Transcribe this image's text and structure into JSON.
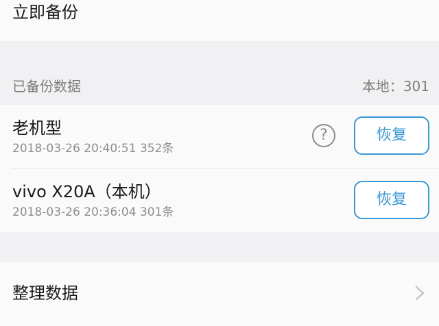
{
  "backup_now": {
    "label": "立即备份"
  },
  "backed_up": {
    "title": "已备份数据",
    "local_count": "本地：301"
  },
  "backups": [
    {
      "name": "老机型",
      "meta": "2018-03-26 20:40:51 352条",
      "help_icon": "?",
      "restore_label": "恢复"
    },
    {
      "name": "vivo X20A（本机）",
      "meta": "2018-03-26 20:36:04 301条",
      "restore_label": "恢复"
    }
  ],
  "organize": {
    "label": "整理数据"
  },
  "colors": {
    "accent": "#3a97d4",
    "background": "#f1f1f3",
    "card": "#fafafa"
  }
}
